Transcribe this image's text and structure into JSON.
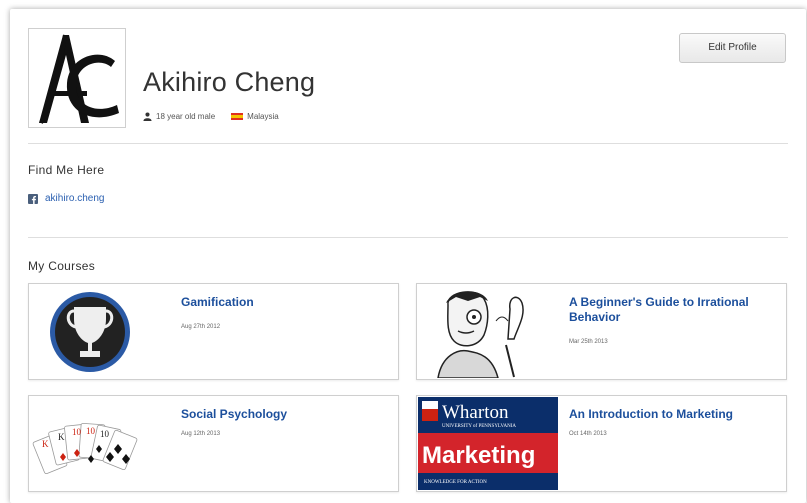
{
  "profile": {
    "name": "Akihiro Cheng",
    "age_gender": "18 year old male",
    "country": "Malaysia",
    "edit_label": "Edit Profile",
    "avatar_initials": "AC"
  },
  "find_me": {
    "title": "Find Me Here",
    "facebook": "akihiro.cheng"
  },
  "courses": {
    "title": "My Courses",
    "items": [
      {
        "title": "Gamification",
        "date": "Aug 27th 2012",
        "thumb": "trophy-icon"
      },
      {
        "title": "A Beginner's Guide to Irrational Behavior",
        "date": "Mar 25th 2013",
        "thumb": "cartoon-man-illustration"
      },
      {
        "title": "Social Psychology",
        "date": "Aug 12th 2013",
        "thumb": "playing-cards-image"
      },
      {
        "title": "An Introduction to Marketing",
        "date": "Oct 14th 2013",
        "thumb": "wharton-marketing-logo",
        "thumb_text": {
          "school": "Wharton",
          "university": "UNIVERSITY of PENNSYLVANIA",
          "subject": "Marketing",
          "tagline": "KNOWLEDGE FOR ACTION"
        }
      }
    ]
  },
  "colors": {
    "link": "#2a5fb0",
    "course_title": "#1c4f9c",
    "wharton_blue": "#0b2e6a",
    "marketing_red": "#d3242b"
  }
}
